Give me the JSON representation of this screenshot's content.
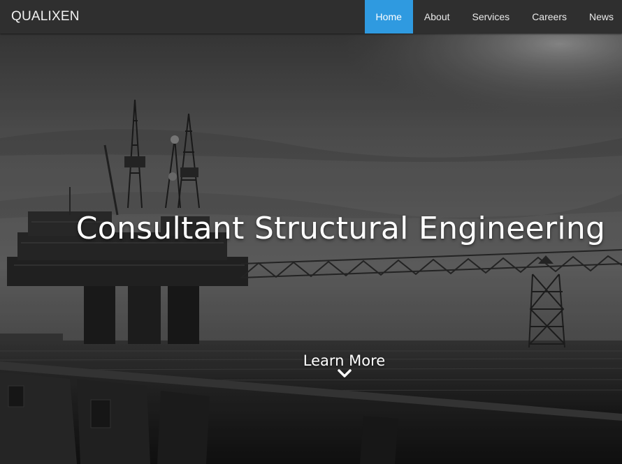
{
  "header": {
    "brand": "QUALIXEN",
    "nav": [
      {
        "label": "Home",
        "active": true
      },
      {
        "label": "About",
        "active": false
      },
      {
        "label": "Services",
        "active": false
      },
      {
        "label": "Careers",
        "active": false
      },
      {
        "label": "News",
        "active": false
      }
    ],
    "active_color": "#2f9ae0",
    "bar_color": "#2f2f2f"
  },
  "hero": {
    "headline": "Consultant Structural Engineering",
    "cta_label": "Learn More",
    "cta_icon": "chevron-down-icon",
    "background": "grayscale offshore oil platform photo"
  }
}
